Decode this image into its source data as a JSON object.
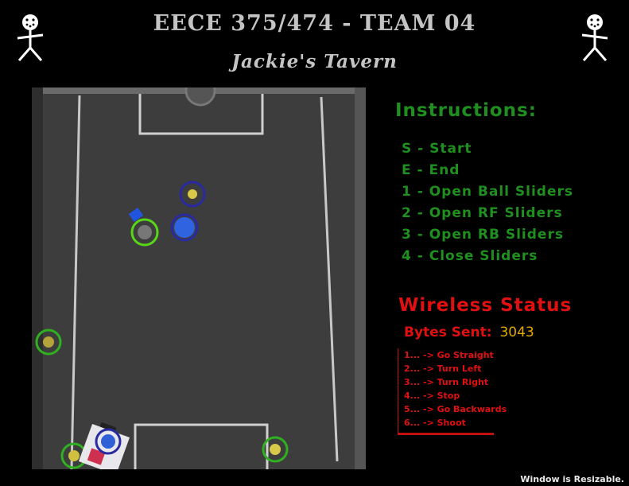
{
  "header": {
    "title": "EECE 375/474 - TEAM 04",
    "subtitle": "Jackie's Tavern"
  },
  "instructions": {
    "title": "Instructions:",
    "items": [
      "S - Start",
      "E - End",
      "1 - Open Ball Sliders",
      "2 - Open RF Sliders",
      "3 - Open RB Sliders",
      "4 - Close Sliders"
    ]
  },
  "wireless": {
    "title": "Wireless Status",
    "bytes_label": "Bytes Sent:",
    "bytes_value": "3043",
    "commands": [
      "1... -> Go Straight",
      "2... -> Turn Left",
      "3... -> Turn Right",
      "4... -> Stop",
      "5... -> Go Backwards",
      "6... -> Shoot"
    ]
  },
  "footer": {
    "note": "Window is Resizable."
  },
  "colors": {
    "title": "#c4c4c4",
    "instructions": "#1f8f1f",
    "wireless": "#e01010",
    "bytes_value": "#e0a800",
    "field": "#3c3c3c",
    "marker_green": "#58d618",
    "marker_blue": "#2a2aa0"
  },
  "icons": {
    "stick_figure": "stick-figure-icon"
  }
}
